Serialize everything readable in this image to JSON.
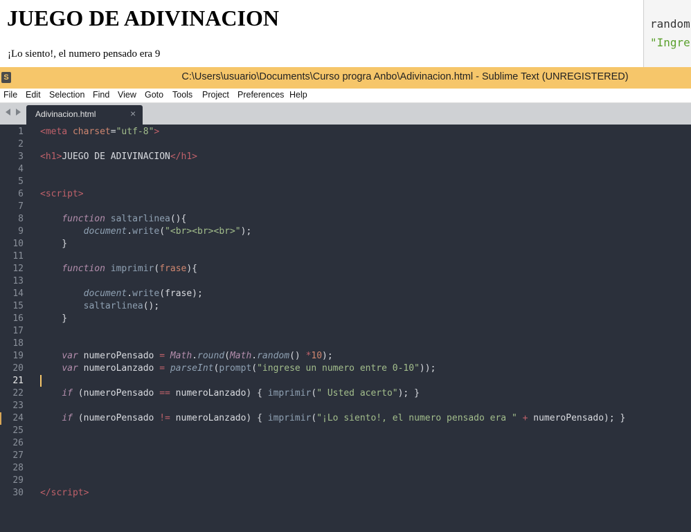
{
  "browser": {
    "heading": "JUEGO DE ADIVINACION",
    "message": "¡Lo siento!, el numero pensado era 9",
    "console_lines": [
      "random",
      "\"Ingre"
    ]
  },
  "window": {
    "title": "C:\\Users\\usuario\\Documents\\Curso progra Anbo\\Adivinacion.html - Sublime Text (UNREGISTERED)"
  },
  "menu": [
    "File",
    "Edit",
    "Selection",
    "Find",
    "View",
    "Goto",
    "Tools",
    "Project",
    "Preferences",
    "Help"
  ],
  "tab": {
    "label": "Adivinacion.html",
    "close": "×"
  },
  "editor": {
    "active_line": 21,
    "line_numbers": [
      "1",
      "2",
      "3",
      "4",
      "5",
      "6",
      "7",
      "8",
      "9",
      "10",
      "11",
      "12",
      "13",
      "14",
      "15",
      "16",
      "17",
      "18",
      "19",
      "20",
      "21",
      "22",
      "23",
      "24",
      "25",
      "26",
      "27",
      "28",
      "29",
      "30"
    ],
    "lines": {
      "l1": [
        "<",
        "meta",
        " ",
        "charset",
        "=",
        "\"utf-8\"",
        ">"
      ],
      "l3": [
        "<",
        "h1",
        ">",
        "JUEGO DE ADIVINACION",
        "</",
        "h1",
        ">"
      ],
      "l6": [
        "<",
        "script",
        ">"
      ],
      "l8": [
        "    ",
        "function",
        " ",
        "saltarlinea",
        "(){"
      ],
      "l9": [
        "        ",
        "document",
        ".",
        "write",
        "(",
        "\"<br><br><br>\"",
        ");"
      ],
      "l10": [
        "    }"
      ],
      "l12": [
        "    ",
        "function",
        " ",
        "imprimir",
        "(",
        "frase",
        "){"
      ],
      "l14": [
        "        ",
        "document",
        ".",
        "write",
        "(frase);"
      ],
      "l15": [
        "        ",
        "saltarlinea",
        "();"
      ],
      "l16": [
        "    }"
      ],
      "l19": [
        "    ",
        "var",
        " numeroPensado ",
        "=",
        " ",
        "Math",
        ".",
        "round",
        "(",
        "Math",
        ".",
        "random",
        "() ",
        "*",
        "10",
        ");"
      ],
      "l20": [
        "    ",
        "var",
        " numeroLanzado ",
        "=",
        " ",
        "parseInt",
        "(",
        "prompt",
        "(",
        "\"ingrese un numero entre 0-10\"",
        "));"
      ],
      "l22": [
        "    ",
        "if",
        " (numeroPensado ",
        "==",
        " numeroLanzado) { ",
        "imprimir",
        "(",
        "\" Usted acerto\"",
        "); }"
      ],
      "l24": [
        "    ",
        "if",
        " (numeroPensado ",
        "!=",
        " numeroLanzado) { ",
        "imprimir",
        "(",
        "\"¡Lo siento!, el numero pensado era \"",
        " ",
        "+",
        " numeroPensado); }"
      ],
      "l30": [
        "</",
        "script",
        ">"
      ]
    }
  },
  "colors": {
    "editor_bg": "#2b303b",
    "title_bar": "#f6c66a",
    "tag": "#bf616a",
    "string": "#a3be8c",
    "keyword": "#b48ead",
    "function": "#8fa1b3",
    "number": "#d08770"
  }
}
